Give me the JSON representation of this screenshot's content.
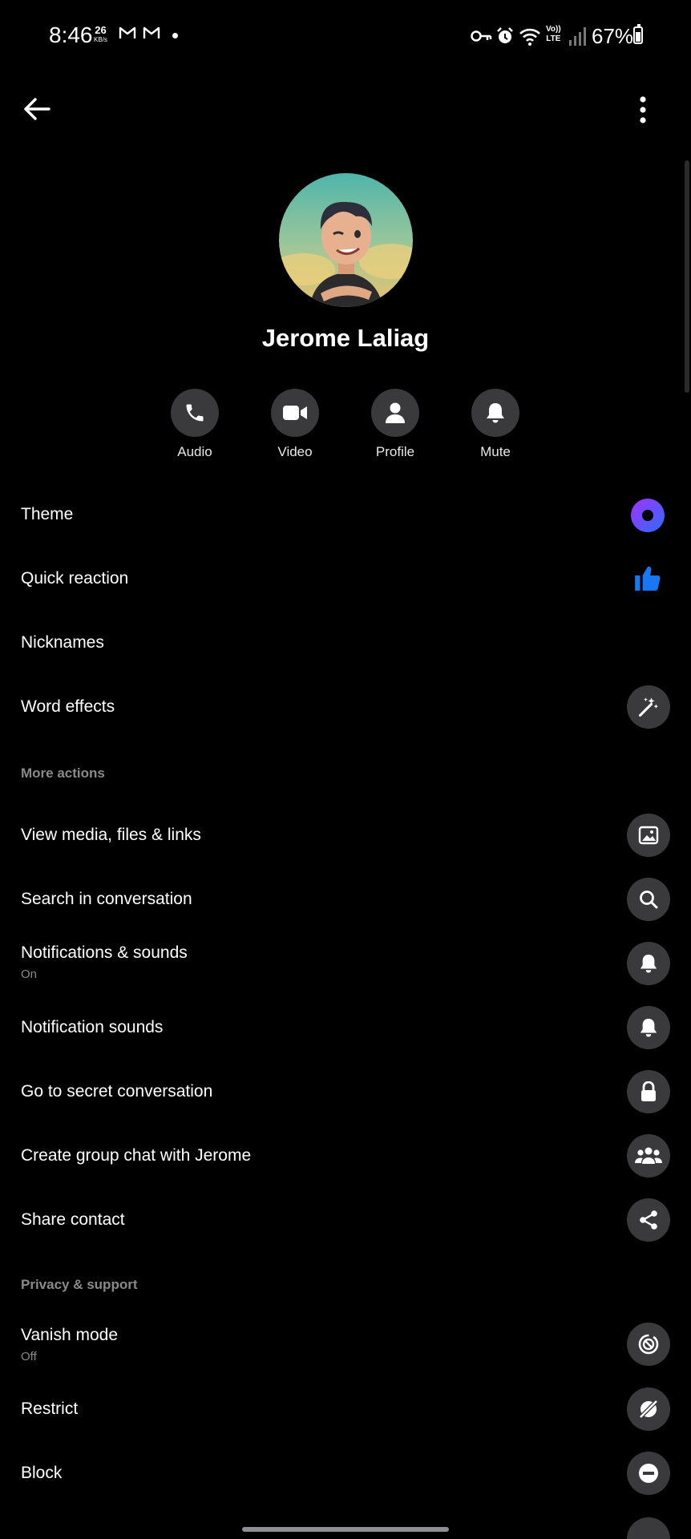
{
  "status_bar": {
    "time": "8:46",
    "net_speed": "26",
    "net_unit": "KB/s",
    "battery": "67%",
    "volte_top": "Vo))",
    "volte_bottom": "LTE",
    "icons": [
      "gmail-icon",
      "gmail-icon",
      "key-icon",
      "alarm-icon",
      "wifi-icon",
      "signal-icon",
      "battery-icon"
    ],
    "battery_level": 0.67
  },
  "header": {
    "back_icon": "back-arrow-icon",
    "more_icon": "more-vertical-icon"
  },
  "profile": {
    "name": "Jerome Laliag"
  },
  "actions": [
    {
      "label": "Audio",
      "icon": "phone-icon"
    },
    {
      "label": "Video",
      "icon": "video-camera-icon"
    },
    {
      "label": "Profile",
      "icon": "person-icon"
    },
    {
      "label": "Mute",
      "icon": "bell-icon"
    }
  ],
  "customization": [
    {
      "label": "Theme",
      "icon": "theme-dot-icon"
    },
    {
      "label": "Quick reaction",
      "icon": "thumbs-up-icon"
    },
    {
      "label": "Nicknames"
    },
    {
      "label": "Word effects",
      "icon": "magic-wand-icon"
    }
  ],
  "more_actions": {
    "title": "More actions",
    "items": [
      {
        "label": "View media, files & links",
        "icon": "image-icon"
      },
      {
        "label": "Search in conversation",
        "icon": "search-icon"
      },
      {
        "label": "Notifications & sounds",
        "sub": "On",
        "icon": "bell-icon"
      },
      {
        "label": "Notification sounds",
        "icon": "bell-icon"
      },
      {
        "label": "Go to secret conversation",
        "icon": "lock-icon"
      },
      {
        "label": "Create group chat with Jerome",
        "icon": "group-icon"
      },
      {
        "label": "Share contact",
        "icon": "share-icon"
      }
    ]
  },
  "privacy": {
    "title": "Privacy & support",
    "items": [
      {
        "label": "Vanish mode",
        "sub": "Off",
        "icon": "vanish-mode-icon"
      },
      {
        "label": "Restrict",
        "icon": "restrict-icon"
      },
      {
        "label": "Block",
        "icon": "block-icon"
      }
    ]
  },
  "colors": {
    "background": "#000000",
    "icon_circle": "#3a3a3c",
    "accent_theme": "#5b4cf0",
    "quick_reaction": "#1877f2",
    "secondary_text": "#8a8a8d"
  }
}
